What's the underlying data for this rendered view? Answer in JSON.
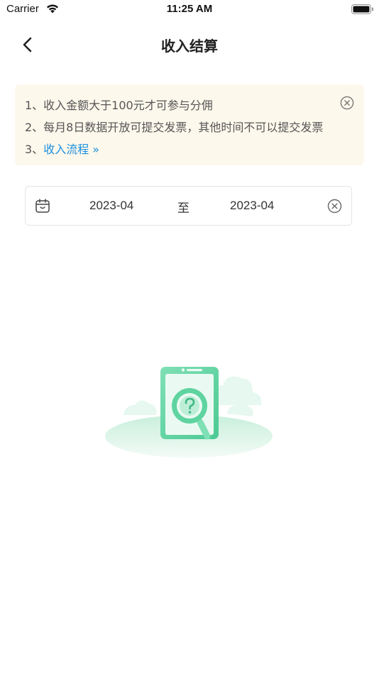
{
  "status_bar": {
    "carrier": "Carrier",
    "time": "11:25 AM",
    "wifi_icon": "wifi-icon",
    "battery_icon": "battery-icon"
  },
  "nav": {
    "title": "收入结算",
    "back_icon": "chevron-left-icon"
  },
  "notice": {
    "line1": "1、收入金额大于100元才可参与分佣",
    "line2": "2、每月8日数据开放可提交发票，其他时间不可以提交发票",
    "line3_prefix": "3、",
    "line3_link": "收入流程 »",
    "close_icon": "close-circle-icon"
  },
  "date_range": {
    "calendar_icon": "calendar-icon",
    "start": "2023-04",
    "separator": "至",
    "end": "2023-04",
    "clear_icon": "clear-circle-icon"
  },
  "empty_state": {
    "icon": "empty-search-illustration"
  },
  "colors": {
    "notice_bg": "#fdf8ec",
    "link": "#1a8fe0",
    "illustration_green": "#5fd4a0"
  }
}
